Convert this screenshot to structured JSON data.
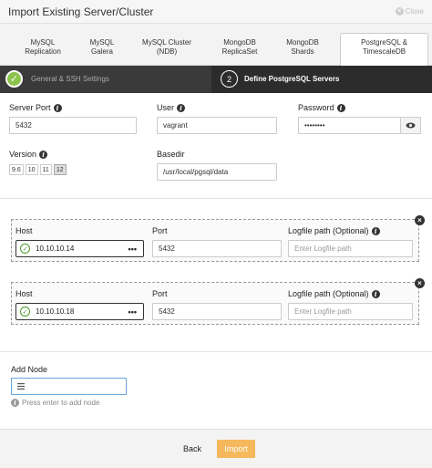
{
  "dialog": {
    "title": "Import Existing Server/Cluster",
    "close_label": "Close"
  },
  "tabs": [
    {
      "line1": "MySQL",
      "line2": "Replication",
      "active": false
    },
    {
      "line1": "MySQL",
      "line2": "Galera",
      "active": false
    },
    {
      "line1": "MySQL Cluster",
      "line2": "(NDB)",
      "active": false
    },
    {
      "line1": "MongoDB",
      "line2": "ReplicaSet",
      "active": false
    },
    {
      "line1": "MongoDB",
      "line2": "Shards",
      "active": false
    },
    {
      "line1": "PostgreSQL &",
      "line2": "TimescaleDB",
      "active": true
    }
  ],
  "steps": {
    "step1": {
      "label": "General & SSH Settings",
      "completed": true
    },
    "step2": {
      "number": "2",
      "label": "Define PostgreSQL Servers"
    }
  },
  "form": {
    "server_port": {
      "label": "Server Port",
      "value": "5432"
    },
    "user": {
      "label": "User",
      "value": "vagrant"
    },
    "password": {
      "label": "Password",
      "value": "••••••••"
    },
    "version": {
      "label": "Version",
      "options": [
        "9.6",
        "10",
        "11",
        "12"
      ],
      "selected": "12"
    },
    "basedir": {
      "label": "Basedir",
      "value": "/usr/local/pgsql/data"
    }
  },
  "nodes": [
    {
      "host_label": "Host",
      "host": "10.10.10.14",
      "port_label": "Port",
      "port": "5432",
      "logfile_label": "Logfile path (Optional)",
      "logfile_placeholder": "Enter Logfile path"
    },
    {
      "host_label": "Host",
      "host": "10.10.10.18",
      "port_label": "Port",
      "port": "5432",
      "logfile_label": "Logfile path (Optional)",
      "logfile_placeholder": "Enter Logfile path"
    }
  ],
  "add_node": {
    "label": "Add Node",
    "hint": "Press enter to add node"
  },
  "footer": {
    "back_label": "Back",
    "import_label": "Import"
  },
  "colors": {
    "accent_import": "#f5b85c",
    "step_done": "#8cc34a",
    "stepper_bg": "#3a3a3a"
  }
}
